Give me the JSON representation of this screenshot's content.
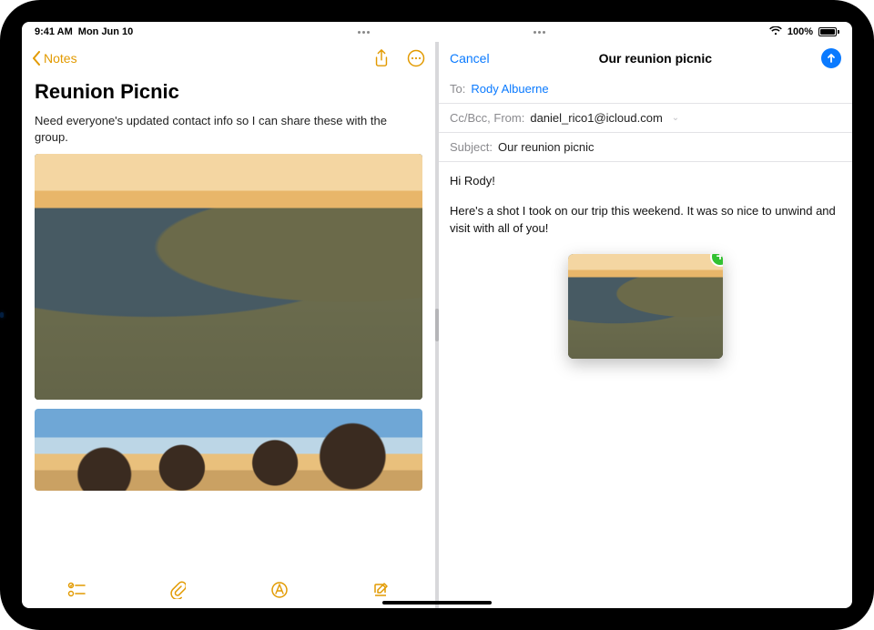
{
  "status": {
    "time": "9:41 AM",
    "date": "Mon Jun 10",
    "battery": "100%"
  },
  "notes": {
    "back_label": "Notes",
    "title": "Reunion Picnic",
    "body": "Need everyone's updated contact info so I can share these with the group."
  },
  "mail": {
    "cancel": "Cancel",
    "title": "Our reunion picnic",
    "to_label": "To:",
    "to_value": "Rody Albuerne",
    "cc_label": "Cc/Bcc, From:",
    "from_value": "daniel_rico1@icloud.com",
    "subject_label": "Subject:",
    "subject_value": "Our reunion picnic",
    "greeting": "Hi Rody!",
    "paragraph": "Here's a shot I took on our trip this weekend. It was so nice to unwind and visit with all of you!"
  },
  "icons": {
    "share": "share-icon",
    "more": "more-icon",
    "checklist": "checklist-icon",
    "attach": "attachment-icon",
    "markup": "markup-icon",
    "compose": "compose-icon",
    "wifi": "wifi-icon",
    "send": "send-icon",
    "chevron_left": "chevron-left-icon",
    "add": "add-icon"
  }
}
